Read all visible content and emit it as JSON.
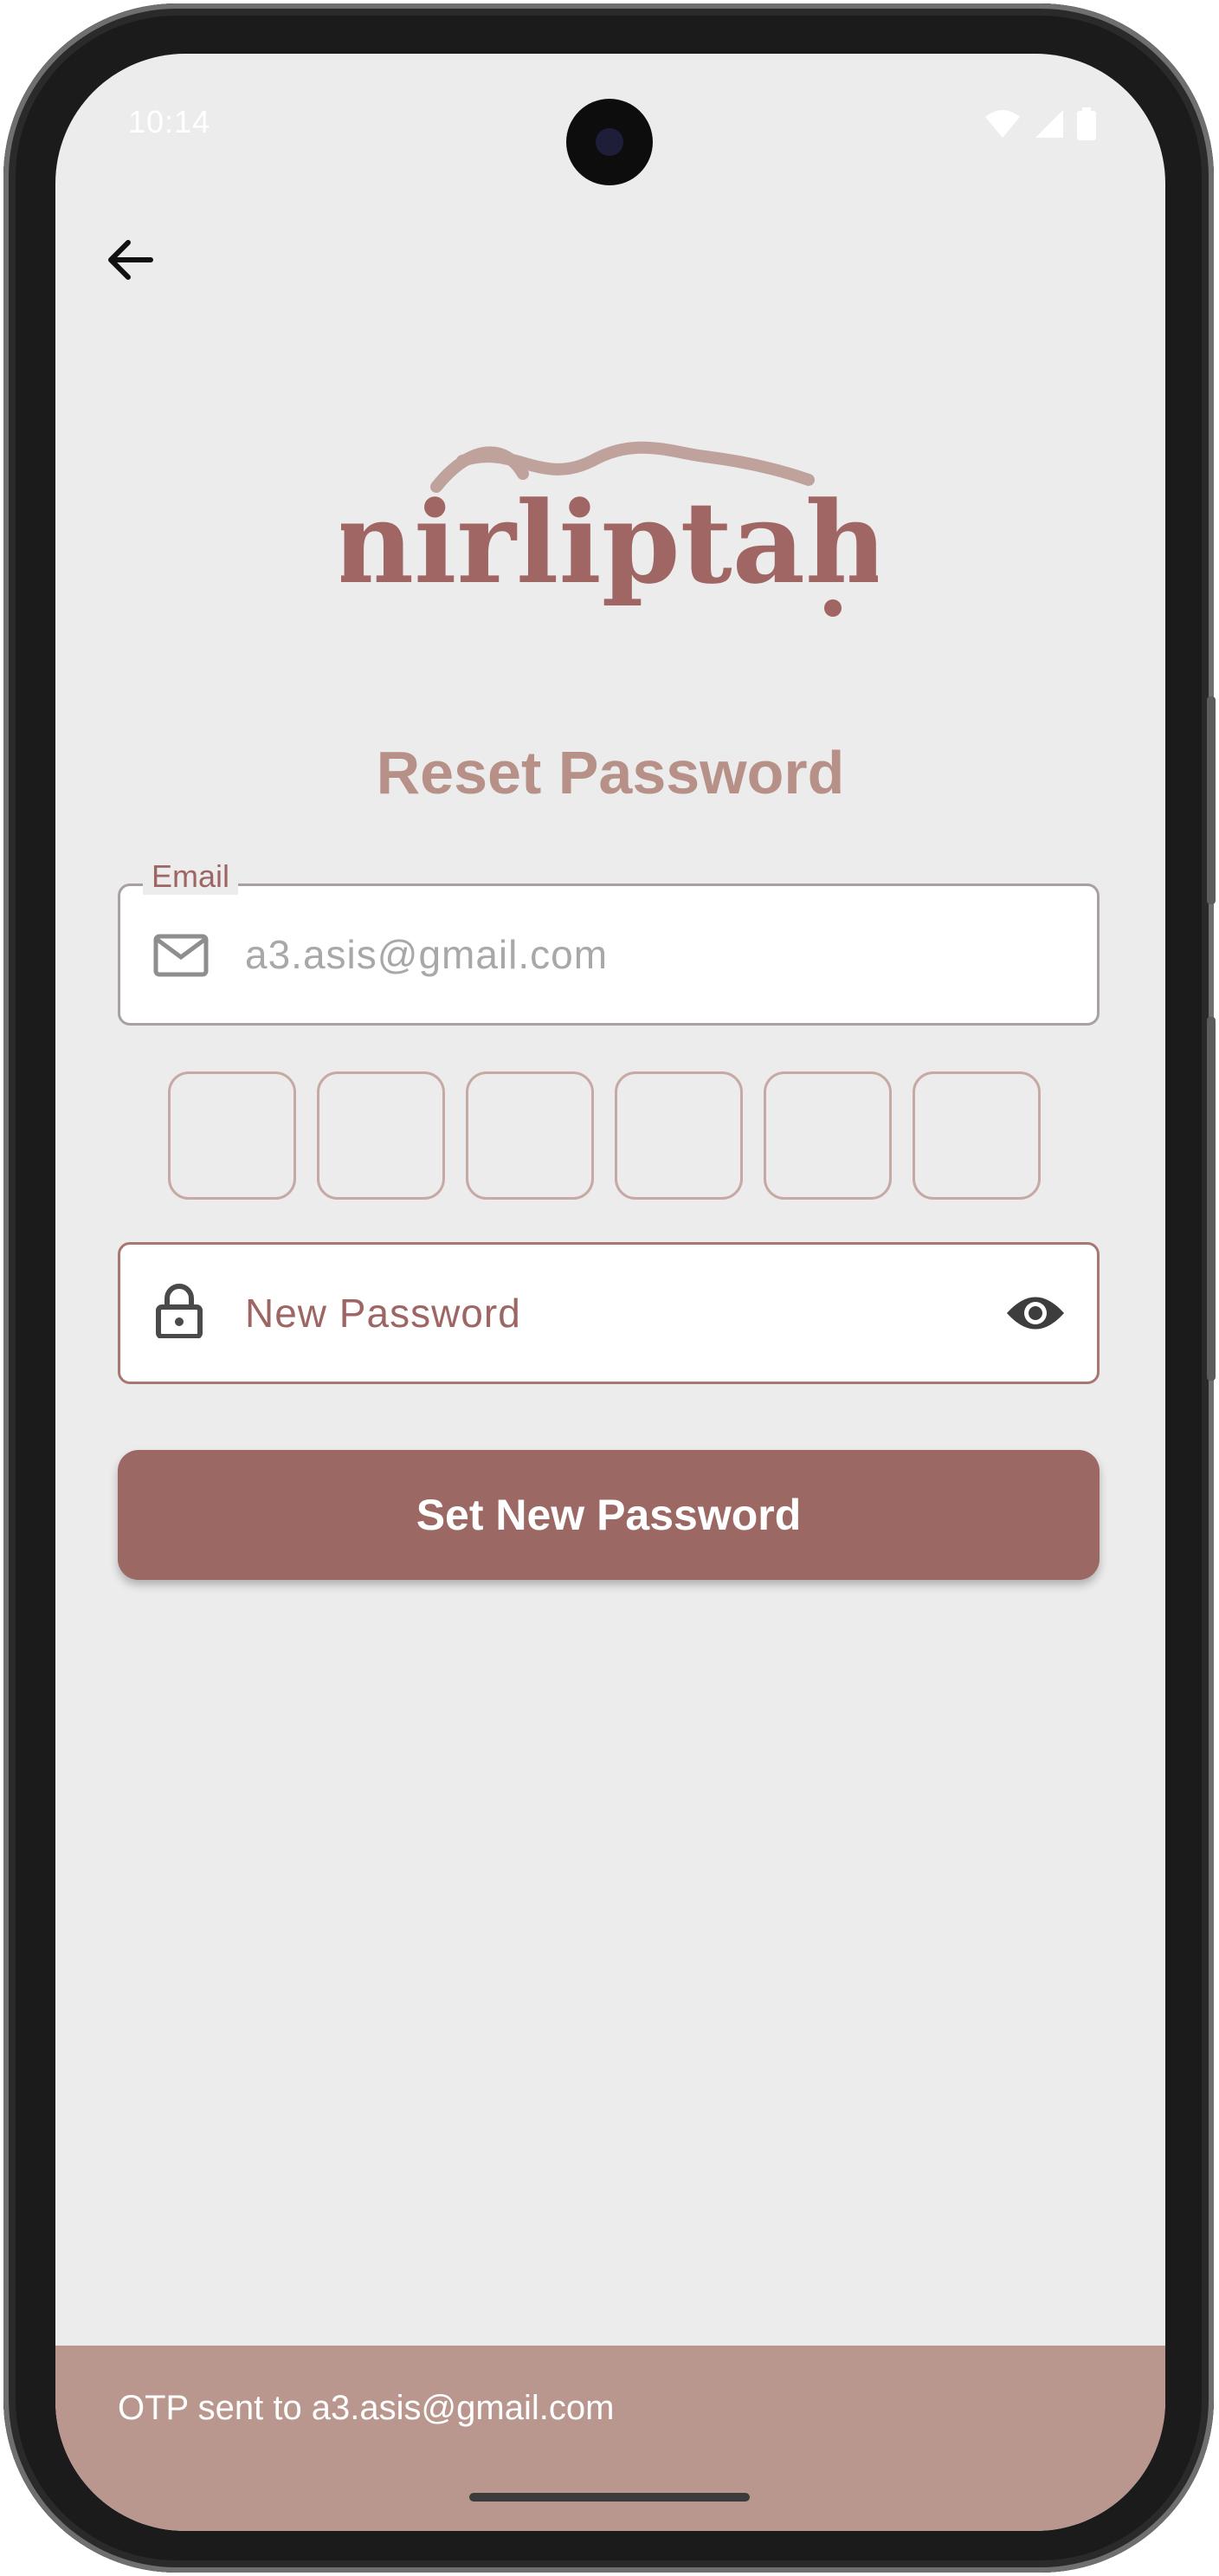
{
  "status_bar": {
    "time": "10:14"
  },
  "brand": {
    "logo_text": "nirliptah"
  },
  "page": {
    "title": "Reset Password"
  },
  "email_field": {
    "label": "Email",
    "value": "a3.asis@gmail.com"
  },
  "otp": {
    "digits": [
      "",
      "",
      "",
      "",
      "",
      ""
    ]
  },
  "password_field": {
    "placeholder": "New Password"
  },
  "actions": {
    "submit_label": "Set New Password"
  },
  "snackbar": {
    "message": "OTP sent to a3.asis@gmail.com"
  },
  "colors": {
    "primary": "#9c6864",
    "title": "#b79187",
    "background": "#ececec",
    "snackbar": "#b9978e"
  }
}
